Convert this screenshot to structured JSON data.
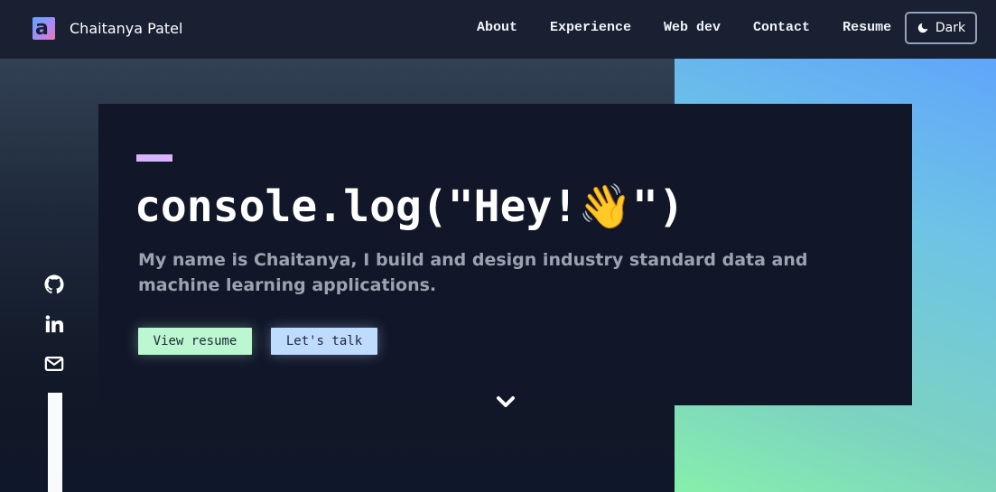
{
  "brand": {
    "name": "Chaitanya Patel",
    "logo_letter": "a"
  },
  "nav": {
    "links": [
      {
        "label": "About"
      },
      {
        "label": "Experience"
      },
      {
        "label": "Web dev"
      },
      {
        "label": "Contact"
      },
      {
        "label": "Resume"
      }
    ],
    "theme_toggle_label": "Dark"
  },
  "hero": {
    "title": "console.log(\"Hey!👋\")",
    "subtitle": "My name is Chaitanya, I build and design industry standard data and machine learning applications.",
    "primary_button": "View resume",
    "secondary_button": "Let's talk"
  },
  "social": {
    "icons": [
      "github-icon",
      "linkedin-icon",
      "mail-icon"
    ]
  },
  "colors": {
    "header_bg": "#182032",
    "card_bg": "#111729",
    "accent_bar": "#d8b4fe",
    "primary_button": "#bbf7d0",
    "secondary_button": "#bfdbfe",
    "subtitle_text": "#9ca3af"
  }
}
